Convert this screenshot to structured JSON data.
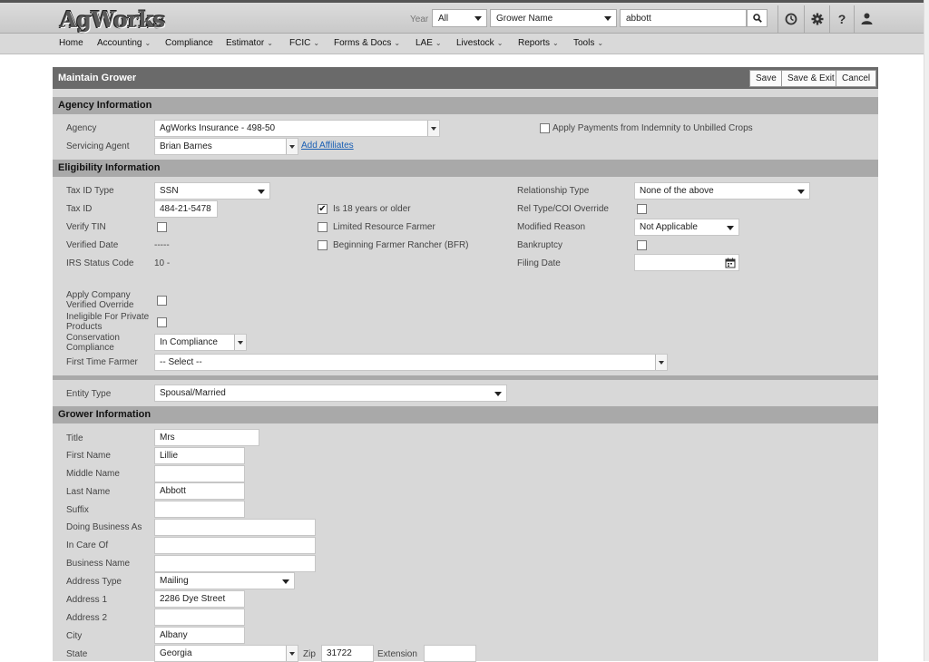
{
  "header": {
    "logo": "AgWorks",
    "year_label": "Year",
    "year_value": "All",
    "search_type": "Grower Name",
    "search_value": "abbott",
    "icons": [
      "search-icon",
      "history-icon",
      "gear-icon",
      "help-icon",
      "user-icon"
    ]
  },
  "nav": {
    "items": [
      "Home",
      "Accounting",
      "Compliance",
      "Estimator",
      "FCIC",
      "Forms & Docs",
      "LAE",
      "Livestock",
      "Reports",
      "Tools"
    ],
    "dd": "⌄"
  },
  "page": {
    "title": "Maintain Grower",
    "save": "Save",
    "save_exit": "Save & Exit",
    "cancel": "Cancel"
  },
  "agency": {
    "header": "Agency Information",
    "agency_label": "Agency",
    "agency_value": "AgWorks Insurance - 498-50",
    "apply_payments_label": "Apply Payments from Indemnity to Unbilled Crops",
    "servicing_agent_label": "Servicing Agent",
    "servicing_agent_value": "Brian Barnes",
    "add_affiliates": "Add Affiliates"
  },
  "eligibility": {
    "header": "Eligibility Information",
    "tax_id_type_label": "Tax ID Type",
    "tax_id_type_value": "SSN",
    "tax_id_label": "Tax ID",
    "tax_id_value": "484-21-5478",
    "verify_tin_label": "Verify TIN",
    "verified_date_label": "Verified Date",
    "verified_date_value": "-----",
    "irs_status_label": "IRS Status Code",
    "irs_status_value": "10 -",
    "is18_label": "Is 18 years or older",
    "is18_checked": "✔",
    "limited_resource_label": "Limited Resource Farmer",
    "bfr_label": "Beginning Farmer Rancher (BFR)",
    "relationship_type_label": "Relationship Type",
    "relationship_type_value": "None of the above",
    "rel_override_label": "Rel Type/COI Override",
    "modified_reason_label": "Modified Reason",
    "modified_reason_value": "Not Applicable",
    "bankruptcy_label": "Bankruptcy",
    "filing_date_label": "Filing Date",
    "apply_company_label": "Apply Company Verified Override",
    "ineligible_private_label": "Ineligible For Private Products",
    "conservation_label": "Conservation Compliance",
    "conservation_value": "In Compliance",
    "first_time_farmer_label": "First Time Farmer",
    "first_time_farmer_value": "-- Select --"
  },
  "entity": {
    "label": "Entity Type",
    "value": "Spousal/Married"
  },
  "grower": {
    "header": "Grower Information",
    "title_label": "Title",
    "title_value": "Mrs",
    "first_name_label": "First Name",
    "first_name_value": "Lillie",
    "middle_name_label": "Middle Name",
    "middle_name_value": "",
    "last_name_label": "Last Name",
    "last_name_value": "Abbott",
    "suffix_label": "Suffix",
    "suffix_value": "",
    "dba_label": "Doing Business As",
    "dba_value": "",
    "care_of_label": "In Care Of",
    "care_of_value": "",
    "business_name_label": "Business Name",
    "business_name_value": "",
    "address_type_label": "Address Type",
    "address_type_value": "Mailing",
    "address1_label": "Address 1",
    "address1_value": "2286 Dye Street",
    "address2_label": "Address 2",
    "address2_value": "",
    "city_label": "City",
    "city_value": "Albany",
    "state_label": "State",
    "state_value": "Georgia",
    "zip_label": "Zip",
    "zip_value": "31722",
    "extension_label": "Extension",
    "extension_value": ""
  }
}
